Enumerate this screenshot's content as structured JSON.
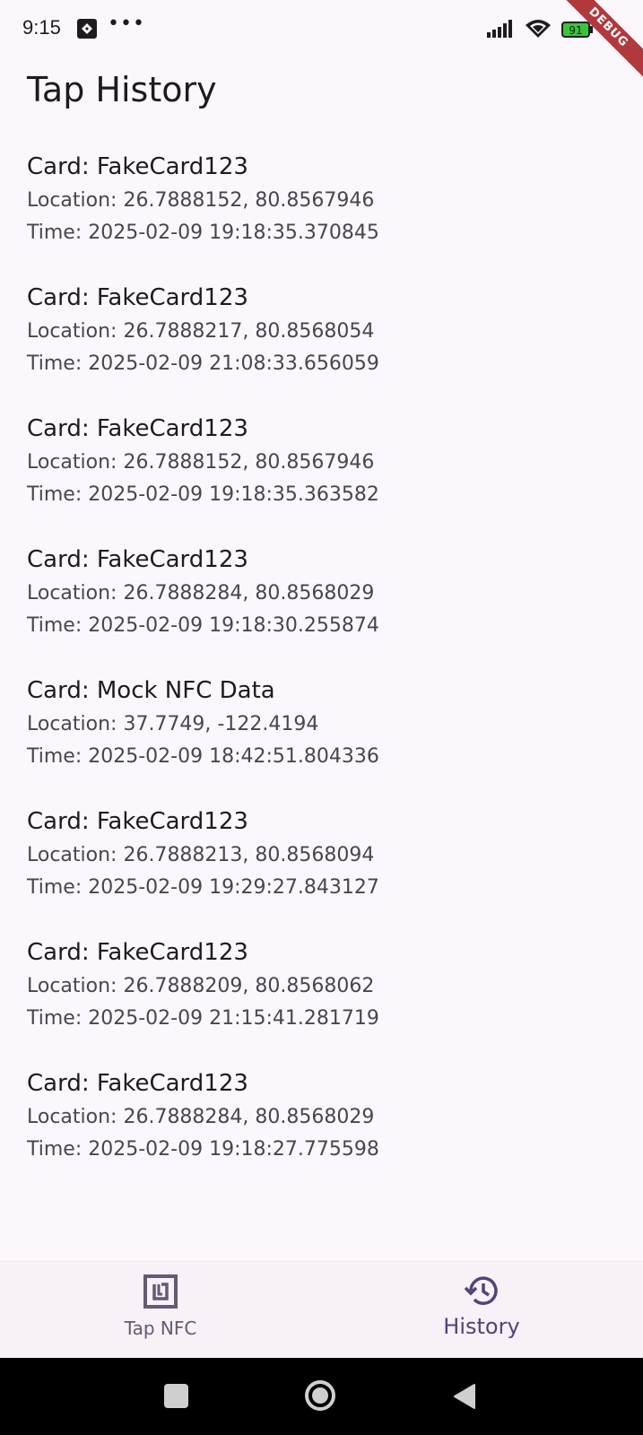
{
  "status_bar": {
    "time": "9:15",
    "more": "•••",
    "battery_level": "91",
    "debug_banner": "DEBUG"
  },
  "page": {
    "title": "Tap History"
  },
  "history": [
    {
      "card": "Card: FakeCard123",
      "location": "Location: 26.7888152, 80.8567946",
      "time": "Time: 2025-02-09 19:18:35.370845"
    },
    {
      "card": "Card: FakeCard123",
      "location": "Location: 26.7888217, 80.8568054",
      "time": "Time: 2025-02-09 21:08:33.656059"
    },
    {
      "card": "Card: FakeCard123",
      "location": "Location: 26.7888152, 80.8567946",
      "time": "Time: 2025-02-09 19:18:35.363582"
    },
    {
      "card": "Card: FakeCard123",
      "location": "Location: 26.7888284, 80.8568029",
      "time": "Time: 2025-02-09 19:18:30.255874"
    },
    {
      "card": "Card: Mock NFC Data",
      "location": "Location: 37.7749, -122.4194",
      "time": "Time: 2025-02-09 18:42:51.804336"
    },
    {
      "card": "Card: FakeCard123",
      "location": "Location: 26.7888213, 80.8568094",
      "time": "Time: 2025-02-09 19:29:27.843127"
    },
    {
      "card": "Card: FakeCard123",
      "location": "Location: 26.7888209, 80.8568062",
      "time": "Time: 2025-02-09 21:15:41.281719"
    },
    {
      "card": "Card: FakeCard123",
      "location": "Location: 26.7888284, 80.8568029",
      "time": "Time: 2025-02-09 19:18:27.775598"
    }
  ],
  "bottom_nav": {
    "items": [
      {
        "label": "Tap NFC",
        "icon": "nfc-icon",
        "selected": false
      },
      {
        "label": "History",
        "icon": "history-icon",
        "selected": true
      }
    ]
  },
  "colors": {
    "background": "#fcf7fc",
    "primary_text": "#1d1b20",
    "secondary_text": "#49454f",
    "nav_selected": "#4f4577",
    "debug_ribbon": "#b1393d"
  }
}
